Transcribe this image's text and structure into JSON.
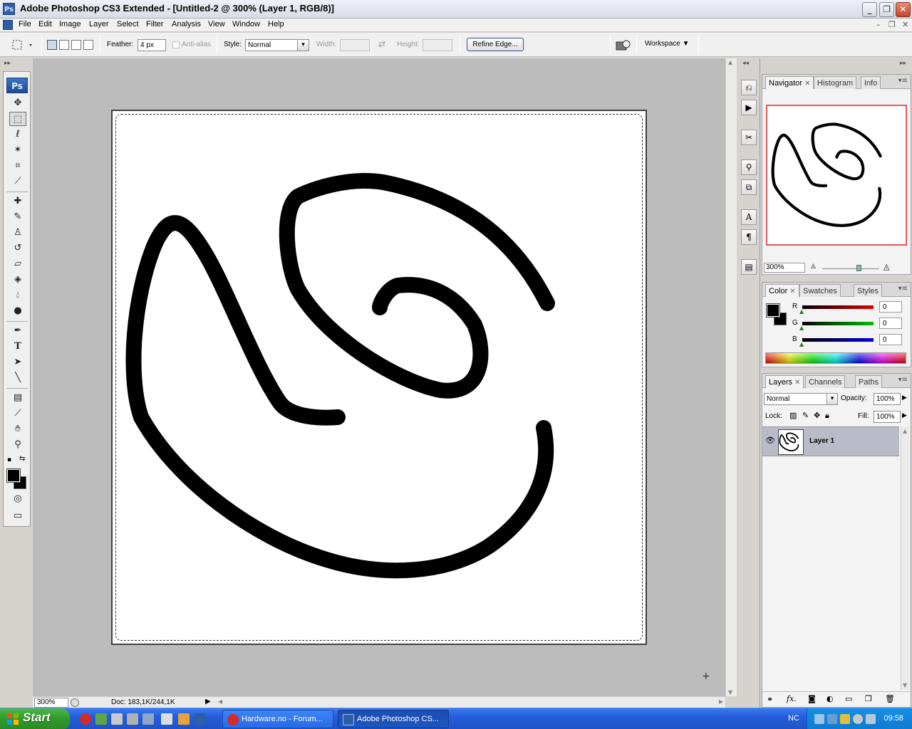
{
  "window": {
    "app_icon": "Ps",
    "title": "Adobe Photoshop CS3 Extended - [Untitled-2 @ 300% (Layer 1, RGB/8)]",
    "minimize": "_",
    "restore": "❐",
    "close": "✕"
  },
  "menu": {
    "items": [
      "File",
      "Edit",
      "Image",
      "Layer",
      "Select",
      "Filter",
      "Analysis",
      "View",
      "Window",
      "Help"
    ],
    "doc_min": "–",
    "doc_restore": "❐",
    "doc_close": "✕"
  },
  "options": {
    "feather_label": "Feather:",
    "feather_value": "4 px",
    "antialias_label": "Anti-alias",
    "style_label": "Style:",
    "style_value": "Normal",
    "width_label": "Width:",
    "height_label": "Height:",
    "refine_edge": "Refine Edge...",
    "workspace": "Workspace ▼"
  },
  "toolbox": {
    "logo": "Ps"
  },
  "status": {
    "zoom": "300%",
    "doc": "Doc: 183,1K/244,1K",
    "menu_arrow": "▶"
  },
  "navigator": {
    "tabs": [
      "Navigator",
      "Histogram",
      "Info"
    ],
    "zoom": "300%",
    "preview_border_color": "#e35b5b"
  },
  "color_panel": {
    "tabs": [
      "Color",
      "Swatches",
      "Styles"
    ],
    "channels": [
      {
        "label": "R",
        "value": "0",
        "color": "#e00000"
      },
      {
        "label": "G",
        "value": "0",
        "color": "#00b000"
      },
      {
        "label": "B",
        "value": "0",
        "color": "#0000e0"
      }
    ],
    "foreground": "#000000",
    "background": "#000000"
  },
  "layers_panel": {
    "tabs": [
      "Layers",
      "Channels",
      "Paths"
    ],
    "blend_mode": "Normal",
    "opacity_label": "Opacity:",
    "opacity_value": "100%",
    "lock_label": "Lock:",
    "fill_label": "Fill:",
    "fill_value": "100%",
    "layers": [
      {
        "name": "Layer 1",
        "visible": true,
        "selected": true
      }
    ]
  },
  "taskbar": {
    "start": "Start",
    "tasks": [
      {
        "label": "Hardware.no - Forum...",
        "icon_color": "#d22b2b",
        "active": false
      },
      {
        "label": "Adobe Photoshop CS...",
        "icon_color": "#2d5fa8",
        "active": true
      }
    ],
    "language": "NC",
    "clock": "09:58"
  }
}
